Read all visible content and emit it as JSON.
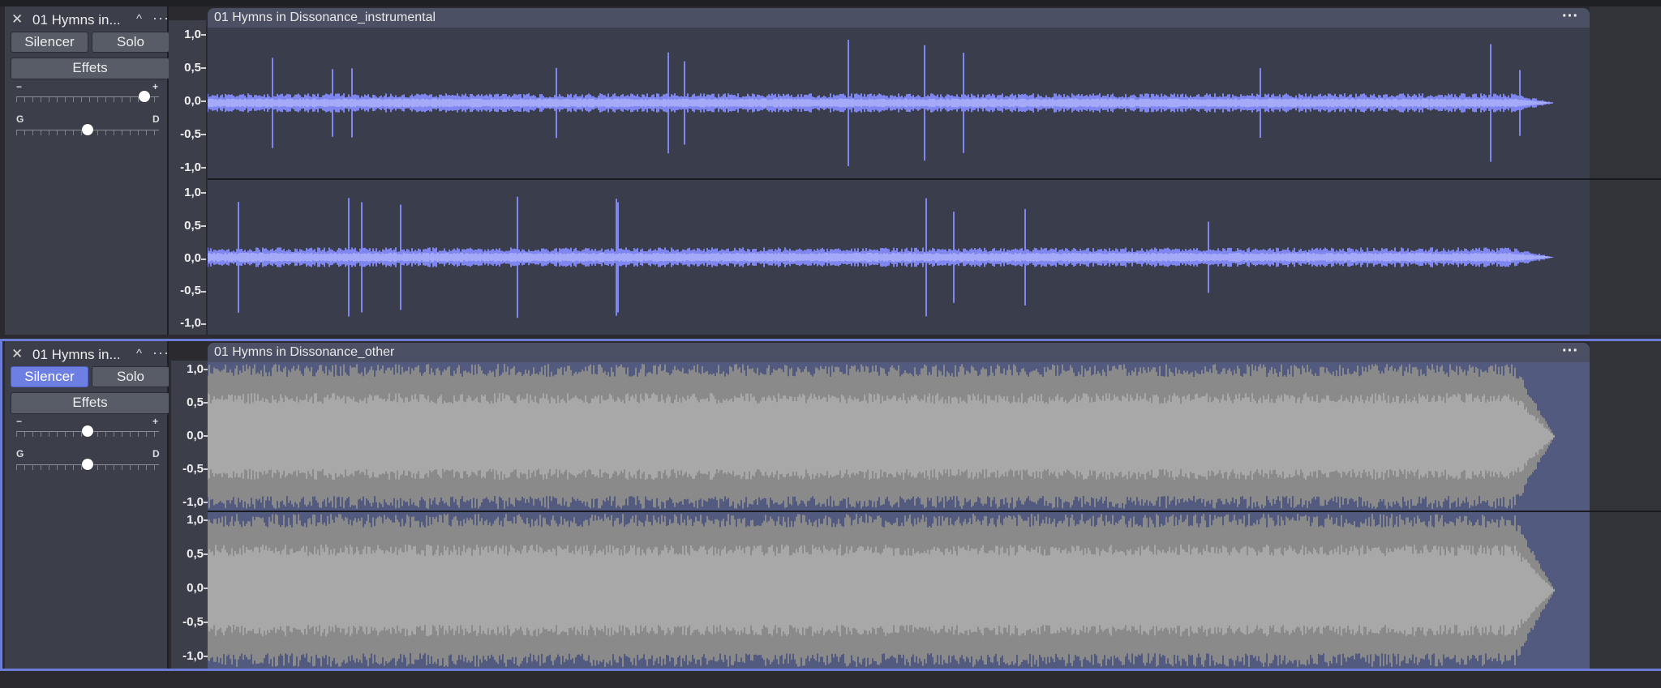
{
  "tracks": [
    {
      "name": "01 Hymns in...",
      "clip_name": "01 Hymns in Dissonance_instrumental",
      "mute_label": "Silencer",
      "solo_label": "Solo",
      "effects_label": "Effets",
      "mute_active": false,
      "gain_minus": "−",
      "gain_plus": "+",
      "pan_left": "G",
      "pan_right": "D",
      "gain_level": 0.9,
      "pan_level": 0.5,
      "selected": false
    },
    {
      "name": "01 Hymns in...",
      "clip_name": "01 Hymns in Dissonance_other",
      "mute_label": "Silencer",
      "solo_label": "Solo",
      "effects_label": "Effets",
      "mute_active": true,
      "gain_minus": "−",
      "gain_plus": "+",
      "pan_left": "G",
      "pan_right": "D",
      "gain_level": 0.5,
      "pan_level": 0.5,
      "selected": true
    }
  ],
  "ruler_labels": [
    "1,0",
    "0,5",
    "0,0",
    "-0,5",
    "-1,0"
  ],
  "icons": {
    "close": "close-icon",
    "collapse": "chevron-up-icon",
    "menu": "more-horizontal-icon"
  },
  "colors": {
    "waveform_blue": "#7f86f0",
    "waveform_blue_rms": "#a4aaf7",
    "clip_bg_1": "#3a3d4c",
    "clip_bg_2": "#525a80",
    "waveform_gray": "#8a8a8a",
    "waveform_gray_rms": "#a8a8a8",
    "accent": "#6d7fe3",
    "control_bg": "#3c3f4a"
  }
}
